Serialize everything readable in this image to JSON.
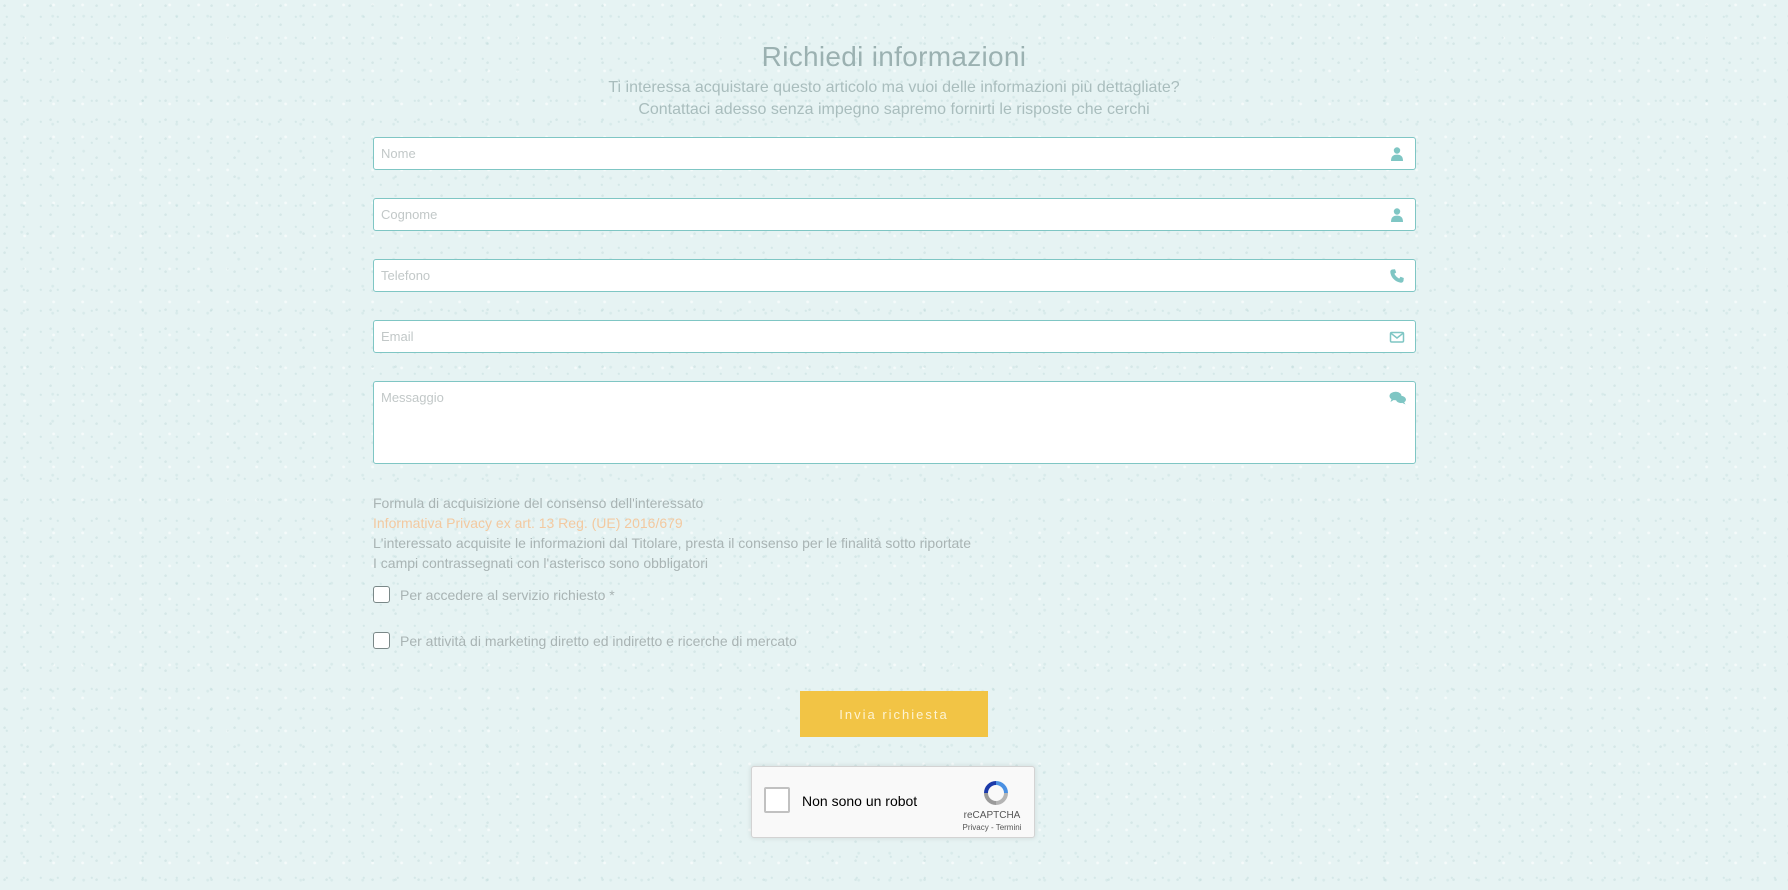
{
  "header": {
    "title": "Richiedi informazioni",
    "subtitle_line1": "Ti interessa acquistare questo articolo ma vuoi delle informazioni più dettagliate?",
    "subtitle_line2": "Contattaci adesso senza impegno sapremo fornirti le risposte che cerchi"
  },
  "form": {
    "fields": [
      {
        "placeholder": "Nome",
        "icon": "user-icon",
        "value": ""
      },
      {
        "placeholder": "Cognome",
        "icon": "user-icon",
        "value": ""
      },
      {
        "placeholder": "Telefono",
        "icon": "phone-icon",
        "value": ""
      },
      {
        "placeholder": "Email",
        "icon": "envelope-icon",
        "value": ""
      },
      {
        "placeholder": "Messaggio",
        "icon": "comments-icon",
        "value": ""
      }
    ],
    "accent_color": "#7fc6c4"
  },
  "consent": {
    "heading": "Formula di acquisizione del consenso dell'interessato",
    "privacy_link": "Informativa Privacy ex art. 13 Reg. (UE) 2016/679",
    "statement": "L'interessato acquisite le informazioni dal Titolare, presta il consenso per le finalità sotto riportate",
    "required_note": "I campi contrassegnati con l'asterisco sono obbligatori",
    "checkbox_service": "Per accedere al servizio richiesto *",
    "checkbox_marketing": "Per attività di marketing diretto ed indiretto e ricerche di mercato"
  },
  "submit": {
    "label": "Invia richiesta",
    "color": "#f2c445"
  },
  "recaptcha": {
    "label": "Non sono un robot",
    "brand": "reCAPTCHA",
    "terms": "Privacy - Termini"
  }
}
